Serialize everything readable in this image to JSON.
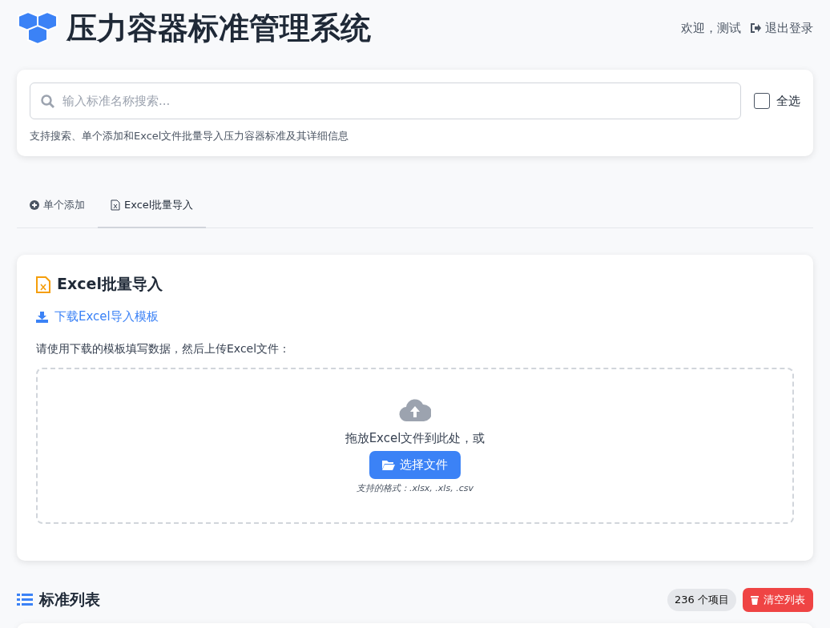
{
  "header": {
    "title": "压力容器标准管理系统",
    "welcome": "欢迎，测试",
    "logout": "退出登录"
  },
  "search": {
    "placeholder": "输入标准名称搜索...",
    "select_all": {
      "label": "全选",
      "checked": false
    },
    "hint": "支持搜索、单个添加和Excel文件批量导入压力容器标准及其详细信息"
  },
  "tabs": [
    {
      "label": "单个添加",
      "kind": "add",
      "selected": false
    },
    {
      "label": "Excel批量导入",
      "kind": "excel",
      "selected": true
    }
  ],
  "import_panel": {
    "title": "Excel批量导入",
    "template_link": "下载Excel导入模板",
    "instruction": "请使用下载的模板填写数据，然后上传Excel文件：",
    "dropzone": {
      "text": "拖放Excel文件到此处，或",
      "button": "选择文件",
      "formats": "支持的格式：.xlsx, .xls, .csv"
    }
  },
  "list": {
    "title": "标准列表",
    "count": "236 个项目",
    "clear_button": "清空列表"
  }
}
